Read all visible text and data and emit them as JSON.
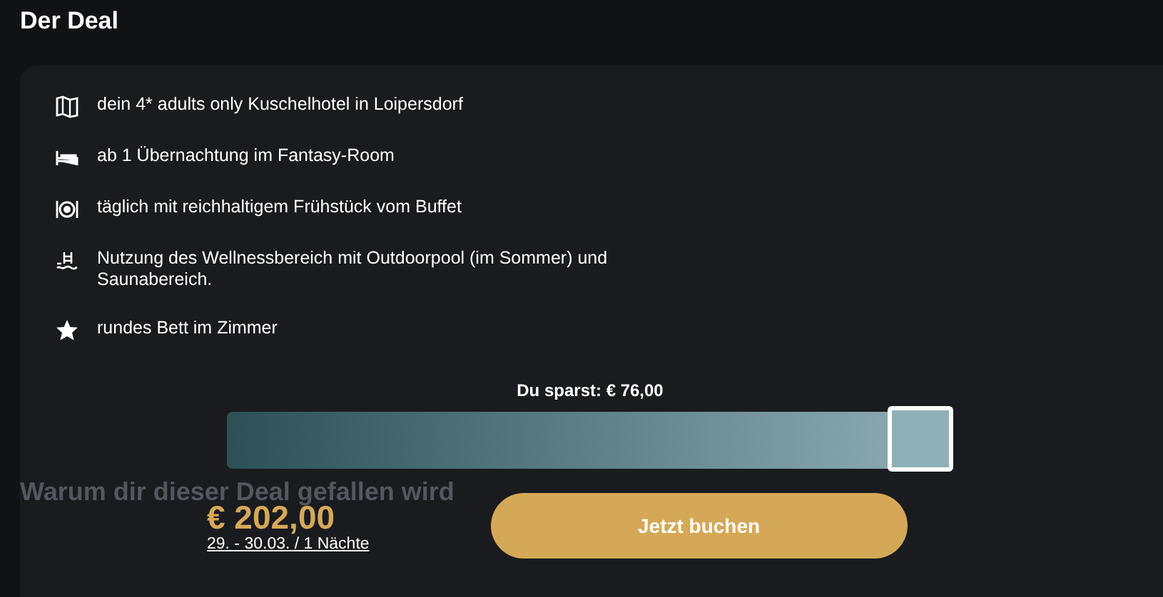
{
  "title": "Der Deal",
  "features": [
    {
      "kind": "map",
      "text": "dein 4* adults only Kuschelhotel in Loipersdorf"
    },
    {
      "kind": "bed",
      "text": "ab 1 Übernachtung im Fantasy-Room"
    },
    {
      "kind": "plate",
      "text": "täglich mit reichhaltigem Frühstück vom Buffet"
    },
    {
      "kind": "pool",
      "text": "Nutzung des Wellnessbereich mit Outdoorpool (im Sommer) und Saunabereich."
    },
    {
      "kind": "star",
      "text": "rundes Bett im Zimmer"
    }
  ],
  "savings": {
    "label": "Du sparst: € 76,00",
    "level": 1
  },
  "background_section": {
    "heading": "Warum dir dieser Deal gefallen wird"
  },
  "booking": {
    "price": "€ 202,00",
    "dates": "29. - 30.03. / 1 Nächte",
    "button": "Jetzt buchen"
  }
}
